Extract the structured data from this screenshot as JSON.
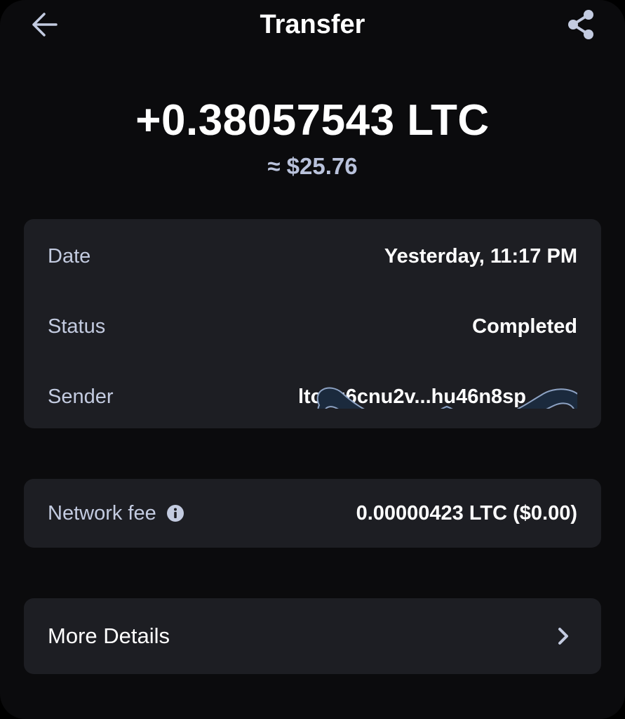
{
  "header": {
    "title": "Transfer",
    "back_icon": "arrow-left-icon",
    "share_icon": "share-icon"
  },
  "transaction": {
    "amount": "+0.38057543 LTC",
    "fiat": "≈ $25.76"
  },
  "details": {
    "date_label": "Date",
    "date_value": "Yesterday, 11:17 PM",
    "status_label": "Status",
    "status_value": "Completed",
    "sender_label": "Sender",
    "sender_value": "ltc1q6cnu2v...hu46n8sp"
  },
  "fee": {
    "label": "Network fee",
    "info_icon": "info-icon",
    "value": "0.00000423 LTC ($0.00)"
  },
  "more": {
    "label": "More Details",
    "chevron_icon": "chevron-right-icon"
  },
  "colors": {
    "background": "#0b0b0d",
    "card": "#1d1e23",
    "label": "#c3cbe0",
    "fiat": "#b9c2db",
    "redaction": "#1b2a3d"
  }
}
